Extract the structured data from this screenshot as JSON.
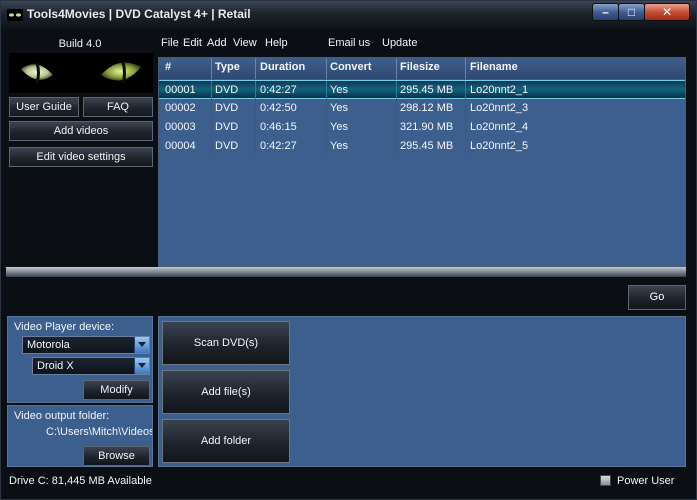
{
  "window": {
    "title": "Tools4Movies | DVD Catalyst 4+ | Retail",
    "minimize_glyph": "–",
    "maximize_glyph": "□",
    "close_glyph": "✕"
  },
  "sidebar": {
    "build": "Build 4.0",
    "user_guide": "User Guide",
    "faq": "FAQ",
    "add_videos": "Add videos",
    "edit_video_settings": "Edit video settings"
  },
  "menu": {
    "file": "File",
    "edit": "Edit",
    "add": "Add",
    "view": "View",
    "help": "Help",
    "email_us": "Email us",
    "update": "Update"
  },
  "list": {
    "columns": [
      "#",
      "Type",
      "Duration",
      "Convert",
      "Filesize",
      "Filename"
    ],
    "rows": [
      [
        "00001",
        "DVD",
        "0:42:27",
        "Yes",
        "295.45 MB",
        "Lo20nnt2_1"
      ],
      [
        "00002",
        "DVD",
        "0:42:50",
        "Yes",
        "298.12 MB",
        "Lo20nnt2_3"
      ],
      [
        "00003",
        "DVD",
        "0:46:15",
        "Yes",
        "321.90 MB",
        "Lo20nnt2_4"
      ],
      [
        "00004",
        "DVD",
        "0:42:27",
        "Yes",
        "295.45 MB",
        "Lo20nnt2_5"
      ]
    ]
  },
  "go_label": "Go",
  "device": {
    "label": "Video Player device:",
    "brand": "Motorola",
    "model": "Droid X",
    "modify": "Modify"
  },
  "output": {
    "label": "Video output folder:",
    "path": "C:\\Users\\Mitch\\Videos\\",
    "browse": "Browse"
  },
  "actions": {
    "scan": "Scan DVD(s)",
    "add_files": "Add file(s)",
    "add_folder": "Add folder"
  },
  "status": {
    "drive": "Drive C: 81,445 MB Available",
    "power_user": "Power User"
  }
}
